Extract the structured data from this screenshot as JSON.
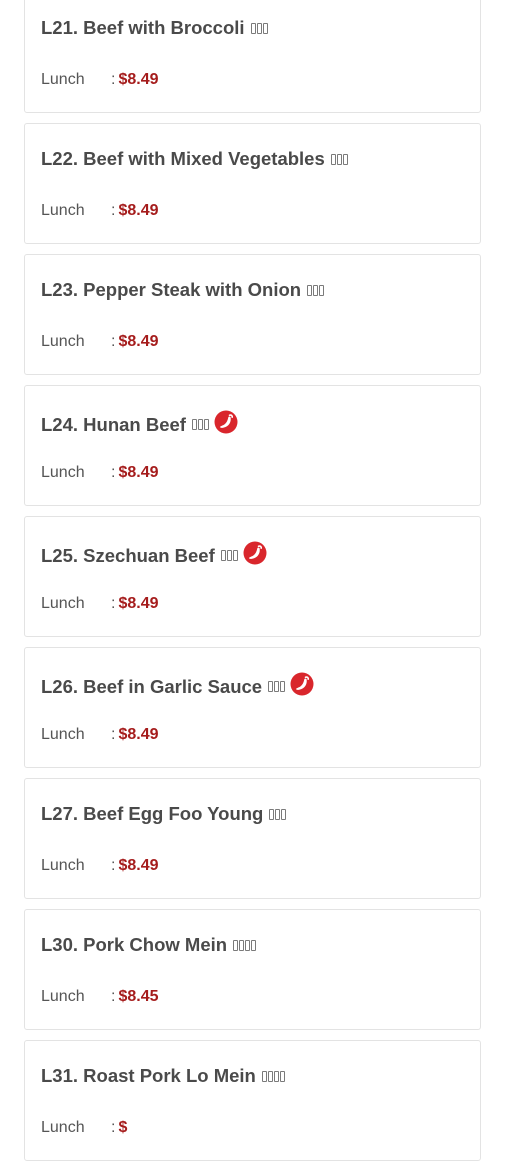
{
  "menu": {
    "items": [
      {
        "title": "L21. Beef with Broccoli",
        "cn_chars": 3,
        "spicy": false,
        "price_label": "Lunch",
        "price": "$8.49"
      },
      {
        "title": "L22. Beef with Mixed Vegetables",
        "cn_chars": 3,
        "spicy": false,
        "price_label": "Lunch",
        "price": "$8.49"
      },
      {
        "title": "L23. Pepper Steak with Onion",
        "cn_chars": 3,
        "spicy": false,
        "price_label": "Lunch",
        "price": "$8.49"
      },
      {
        "title": "L24. Hunan Beef",
        "cn_chars": 3,
        "spicy": true,
        "price_label": "Lunch",
        "price": "$8.49"
      },
      {
        "title": "L25. Szechuan Beef",
        "cn_chars": 3,
        "spicy": true,
        "price_label": "Lunch",
        "price": "$8.49"
      },
      {
        "title": "L26. Beef in Garlic Sauce",
        "cn_chars": 3,
        "spicy": true,
        "price_label": "Lunch",
        "price": "$8.49"
      },
      {
        "title": "L27. Beef Egg Foo Young",
        "cn_chars": 3,
        "spicy": false,
        "price_label": "Lunch",
        "price": "$8.49"
      },
      {
        "title": "L30. Pork Chow Mein",
        "cn_chars": 4,
        "spicy": false,
        "price_label": "Lunch",
        "price": "$8.45"
      },
      {
        "title": "L31. Roast Pork Lo Mein",
        "cn_chars": 4,
        "spicy": false,
        "price_label": "Lunch",
        "price": "$"
      }
    ],
    "price_separator": ":",
    "spicy_icon": "chili-pepper-icon",
    "colors": {
      "accent_price": "#a51c1c",
      "spicy_red": "#d9262c",
      "title_text": "#4a4a4a",
      "card_border": "#e3e3e3"
    }
  }
}
